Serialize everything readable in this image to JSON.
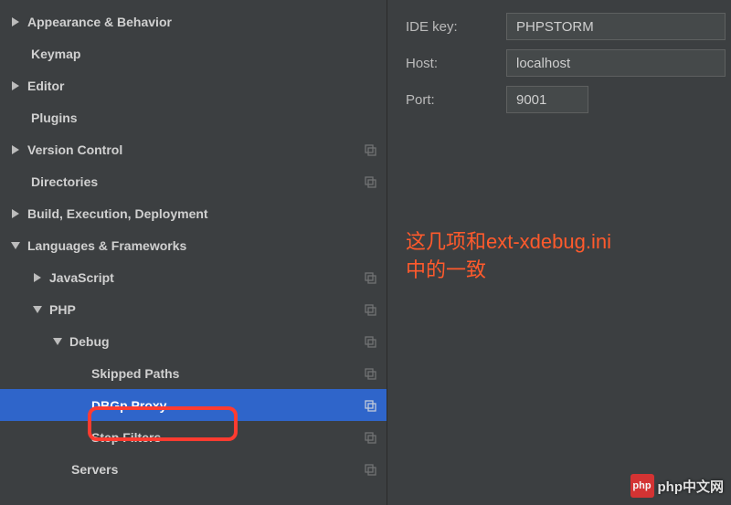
{
  "sidebar": {
    "items": [
      {
        "label": "Appearance & Behavior",
        "indent": 0,
        "arrow": "right",
        "copy": false
      },
      {
        "label": "Keymap",
        "indent": 1,
        "arrow": "none",
        "copy": false
      },
      {
        "label": "Editor",
        "indent": 0,
        "arrow": "right",
        "copy": false
      },
      {
        "label": "Plugins",
        "indent": 1,
        "arrow": "none",
        "copy": false
      },
      {
        "label": "Version Control",
        "indent": 0,
        "arrow": "right",
        "copy": true
      },
      {
        "label": "Directories",
        "indent": 1,
        "arrow": "none",
        "copy": true
      },
      {
        "label": "Build, Execution, Deployment",
        "indent": 0,
        "arrow": "right",
        "copy": false
      },
      {
        "label": "Languages & Frameworks",
        "indent": 0,
        "arrow": "down",
        "copy": false
      },
      {
        "label": "JavaScript",
        "indent": 1,
        "arrow": "right",
        "copy": true
      },
      {
        "label": "PHP",
        "indent": 1,
        "arrow": "down",
        "copy": true
      },
      {
        "label": "Debug",
        "indent": 2,
        "arrow": "down",
        "copy": true
      },
      {
        "label": "Skipped Paths",
        "indent": 3,
        "arrow": "none",
        "copy": true
      },
      {
        "label": "DBGp Proxy",
        "indent": 3,
        "arrow": "none",
        "copy": true,
        "selected": true
      },
      {
        "label": "Step Filters",
        "indent": 3,
        "arrow": "none",
        "copy": true
      },
      {
        "label": "Servers",
        "indent": 2,
        "arrow": "none",
        "copy": true
      }
    ]
  },
  "form": {
    "ide_key_label": "IDE key:",
    "ide_key_value": "PHPSTORM",
    "host_label": "Host:",
    "host_value": "localhost",
    "port_label": "Port:",
    "port_value": "9001"
  },
  "annotation": {
    "line1": "这几项和ext-xdebug.ini",
    "line2": "中的一致"
  },
  "watermark": {
    "logo_text": "php",
    "text": "php中文网"
  }
}
